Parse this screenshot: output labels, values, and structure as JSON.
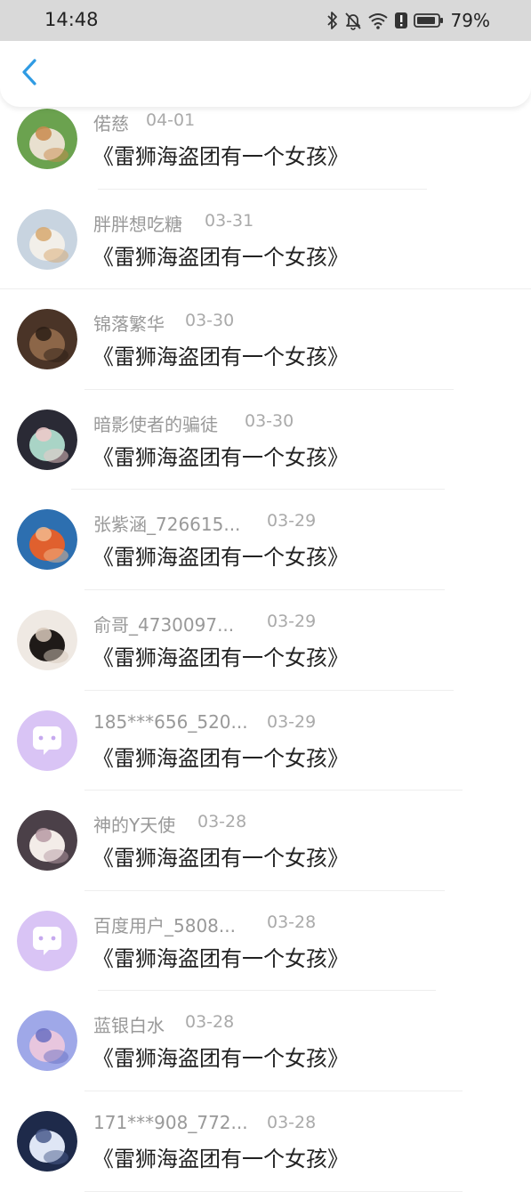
{
  "status_bar": {
    "time": "14:48",
    "battery_percent": "79%",
    "icons": [
      "bluetooth-icon",
      "mute-icon",
      "wifi-icon",
      "alert-icon",
      "battery-icon"
    ]
  },
  "nav": {
    "back_icon": "back-arrow-icon",
    "accent_color": "#2f9be3"
  },
  "comments": [
    {
      "user": "偌慈",
      "date": "04-01",
      "title": "《雷狮海盗团有一个女孩》",
      "avatar": "photo-avatar"
    },
    {
      "user": "胖胖想吃糖",
      "date": "03-31",
      "title": "《雷狮海盗团有一个女孩》",
      "avatar": "photo-avatar"
    },
    {
      "user": "锦落繁华",
      "date": "03-30",
      "title": "《雷狮海盗团有一个女孩》",
      "avatar": "photo-avatar"
    },
    {
      "user": "暗影使者的骗徒",
      "date": "03-30",
      "title": "《雷狮海盗团有一个女孩》",
      "avatar": "photo-avatar"
    },
    {
      "user": "张紫涵_726615...",
      "date": "03-29",
      "title": "《雷狮海盗团有一个女孩》",
      "avatar": "photo-avatar"
    },
    {
      "user": "俞哥_4730097...",
      "date": "03-29",
      "title": "《雷狮海盗团有一个女孩》",
      "avatar": "photo-avatar"
    },
    {
      "user": "185***656_520...",
      "date": "03-29",
      "title": "《雷狮海盗团有一个女孩》",
      "avatar": "default-avatar"
    },
    {
      "user": "神的Y天使",
      "date": "03-28",
      "title": "《雷狮海盗团有一个女孩》",
      "avatar": "photo-avatar"
    },
    {
      "user": "百度用户_5808...",
      "date": "03-28",
      "title": "《雷狮海盗团有一个女孩》",
      "avatar": "default-avatar"
    },
    {
      "user": "蓝银白水",
      "date": "03-28",
      "title": "《雷狮海盗团有一个女孩》",
      "avatar": "photo-avatar"
    },
    {
      "user": "171***908_772...",
      "date": "03-28",
      "title": "《雷狮海盗团有一个女孩》",
      "avatar": "photo-avatar"
    }
  ]
}
